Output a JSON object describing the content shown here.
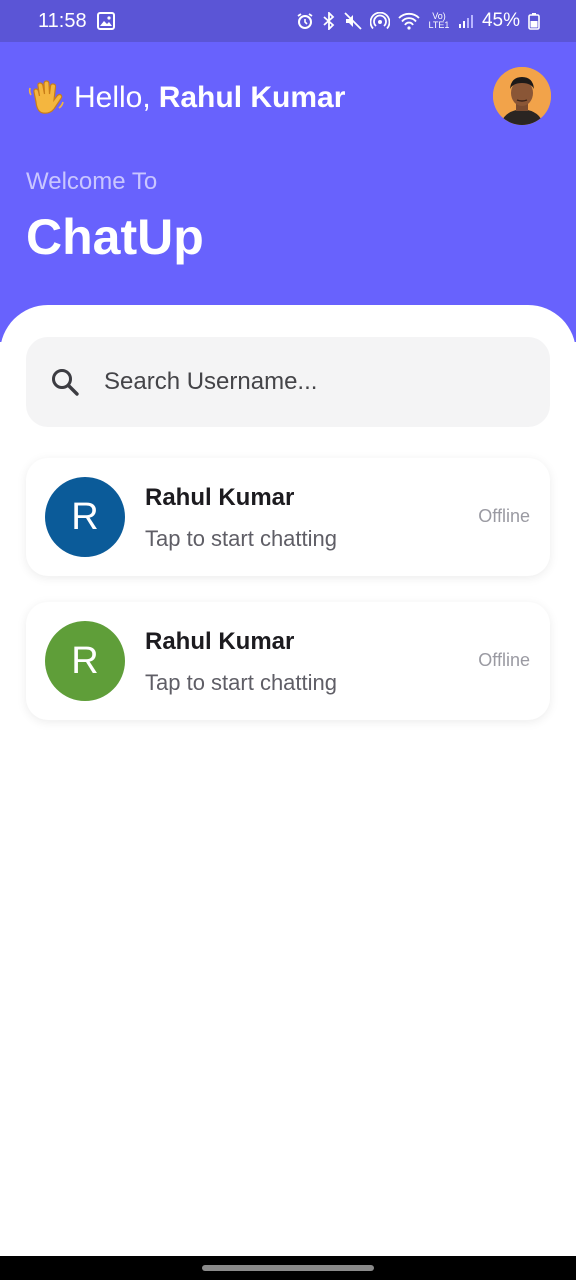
{
  "status_bar": {
    "time": "11:58",
    "battery": "45%",
    "net_label": "Vo) LTE1"
  },
  "header": {
    "greeting_prefix": "Hello,",
    "user_name": "Rahul Kumar",
    "welcome": "Welcome To",
    "app_name": "ChatUp"
  },
  "search": {
    "placeholder": "Search Username...",
    "value": ""
  },
  "users": [
    {
      "initial": "R",
      "name": "Rahul Kumar",
      "subtitle": "Tap to start chatting",
      "status": "Offline",
      "avatar_color": "#0b5b99"
    },
    {
      "initial": "R",
      "name": "Rahul Kumar",
      "subtitle": "Tap to start chatting",
      "status": "Offline",
      "avatar_color": "#5f9e39"
    }
  ],
  "colors": {
    "header_bg": "#6862fd",
    "status_bar_bg": "#5b55d6"
  }
}
